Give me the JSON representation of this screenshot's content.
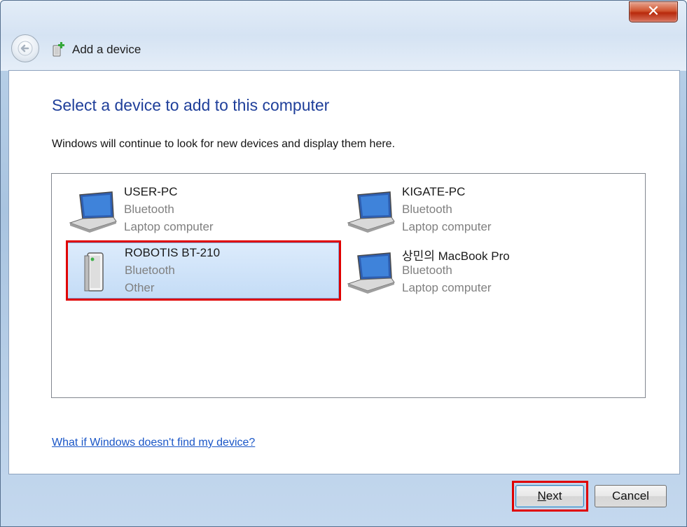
{
  "window": {
    "title": "Add a device",
    "close_glyph": "✕"
  },
  "content": {
    "heading": "Select a device to add to this computer",
    "subtext": "Windows will continue to look for new devices and display them here.",
    "help_link": "What if Windows doesn't find my device?"
  },
  "devices": [
    {
      "name": "USER-PC",
      "connection": "Bluetooth",
      "type": "Laptop computer",
      "icon": "laptop-icon",
      "selected": false
    },
    {
      "name": "KIGATE-PC",
      "connection": "Bluetooth",
      "type": "Laptop computer",
      "icon": "laptop-icon",
      "selected": false
    },
    {
      "name": "ROBOTIS BT-210",
      "connection": "Bluetooth",
      "type": "Other",
      "icon": "generic-device-icon",
      "selected": true
    },
    {
      "name": "상민의 MacBook Pro",
      "connection": "Bluetooth",
      "type": "Laptop computer",
      "icon": "laptop-icon",
      "selected": false
    }
  ],
  "buttons": {
    "next_label": "Next",
    "next_mnemonic": "N",
    "next_rest": "ext",
    "cancel_label": "Cancel"
  },
  "colors": {
    "heading": "#1f3f9a",
    "link": "#1a56c7",
    "annotation_highlight": "#e00000",
    "selection": "#c4dcf6"
  }
}
